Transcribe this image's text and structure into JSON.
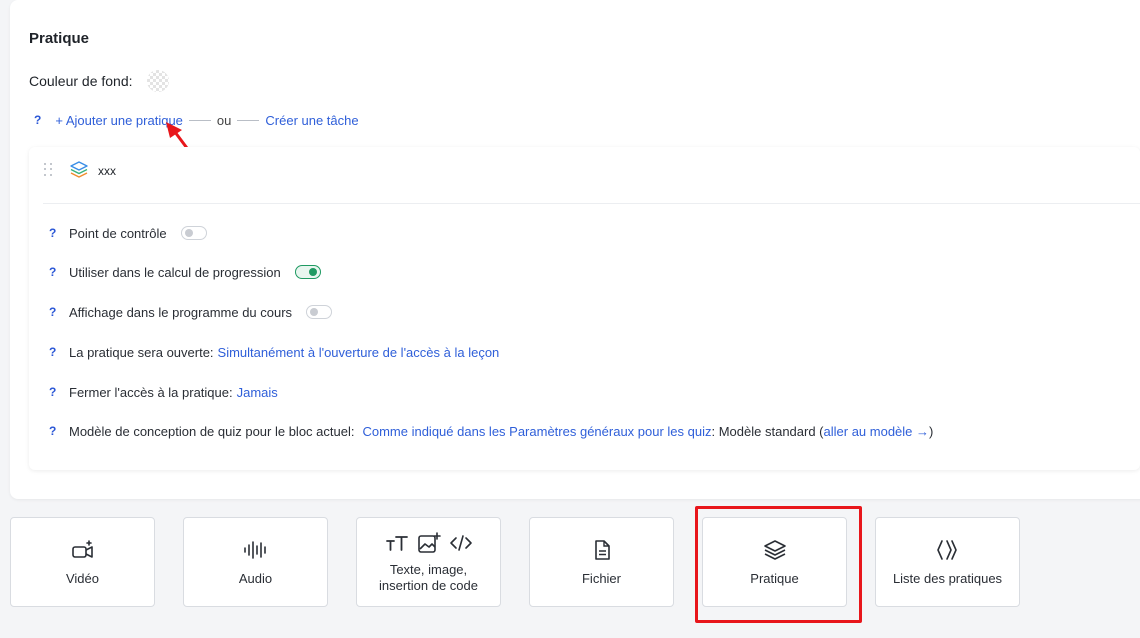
{
  "section": {
    "title": "Pratique",
    "background_label": "Couleur de fond:",
    "help_mark": "?",
    "add_practice_link": "+ Ajouter une pratique",
    "or_text": "ou",
    "create_task_link": "Créer une tâche"
  },
  "block": {
    "name": "xxx",
    "settings": [
      {
        "label": "Point de contrôle",
        "toggle": "off"
      },
      {
        "label": "Utiliser dans le calcul de progression",
        "toggle": "on"
      },
      {
        "label": "Affichage dans le programme du cours",
        "toggle": "off"
      },
      {
        "label": "La pratique sera ouverte:",
        "value": "Simultanément à l'ouverture de l'accès à la leçon"
      },
      {
        "label": "Fermer l'accès à la pratique:",
        "value": "Jamais"
      },
      {
        "label": "Modèle de conception de quiz pour le bloc actuel:",
        "value": "Comme indiqué dans les Paramètres généraux pour les quiz",
        "suffix": ": Modèle standard (",
        "link": "aller au modèle →",
        "close": ")"
      }
    ]
  },
  "tiles": [
    {
      "label": "Vidéo",
      "icon": "video-add-icon"
    },
    {
      "label": "Audio",
      "icon": "audio-wave-icon"
    },
    {
      "label": "Texte, image, insertion de code",
      "icons": [
        "text-size-icon",
        "image-add-icon",
        "code-icon"
      ]
    },
    {
      "label": "Fichier",
      "icon": "file-icon"
    },
    {
      "label": "Pratique",
      "icon": "layers-icon"
    },
    {
      "label": "Liste des pratiques",
      "icon": "chevrons-icon"
    }
  ],
  "colors": {
    "link": "#2f5fd9",
    "toggle_on": "#1f9a62",
    "annotation": "#e8161b"
  }
}
